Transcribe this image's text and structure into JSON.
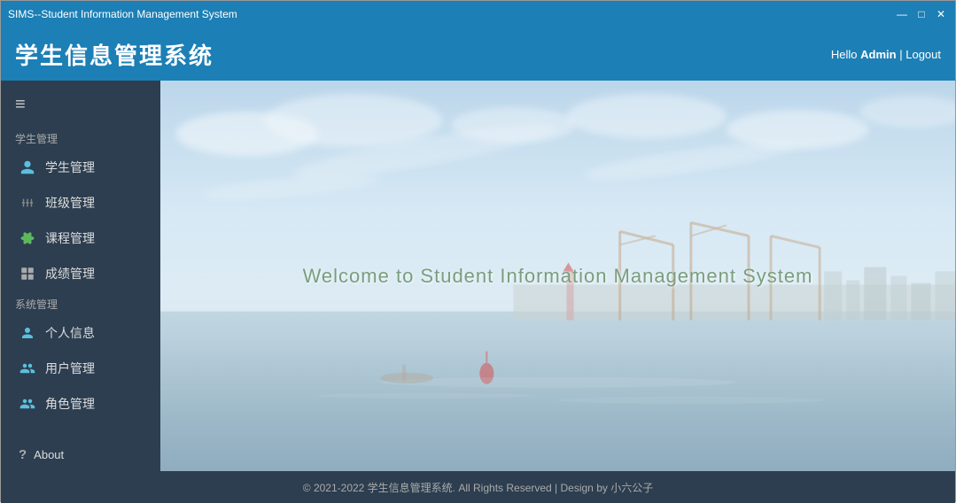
{
  "window": {
    "title": "SIMS--Student Information Management System",
    "controls": {
      "minimize": "—",
      "maximize": "□",
      "close": "✕"
    }
  },
  "header": {
    "app_title": "学生信息管理系统",
    "user_greeting": "Hello",
    "username": "Admin",
    "separator": " | ",
    "logout_label": "Logout"
  },
  "sidebar": {
    "hamburger": "≡",
    "student_section_label": "学生管理",
    "system_section_label": "系统管理",
    "items_student": [
      {
        "id": "student-mgmt",
        "label": "学生管理",
        "icon": "👤"
      },
      {
        "id": "class-mgmt",
        "label": "班级管理",
        "icon": "⚙"
      },
      {
        "id": "course-mgmt",
        "label": "课程管理",
        "icon": "◈"
      },
      {
        "id": "grade-mgmt",
        "label": "成绩管理",
        "icon": "▦"
      }
    ],
    "items_system": [
      {
        "id": "personal-info",
        "label": "个人信息",
        "icon": "👤"
      },
      {
        "id": "user-mgmt",
        "label": "用户管理",
        "icon": "👥"
      },
      {
        "id": "role-mgmt",
        "label": "角色管理",
        "icon": "👥"
      }
    ],
    "about_label": "About",
    "about_icon": "?"
  },
  "main": {
    "welcome_text": "Welcome to Student Information Management System"
  },
  "footer": {
    "text": "© 2021-2022 学生信息管理系统. All Rights Reserved | Design by 小六公子"
  }
}
